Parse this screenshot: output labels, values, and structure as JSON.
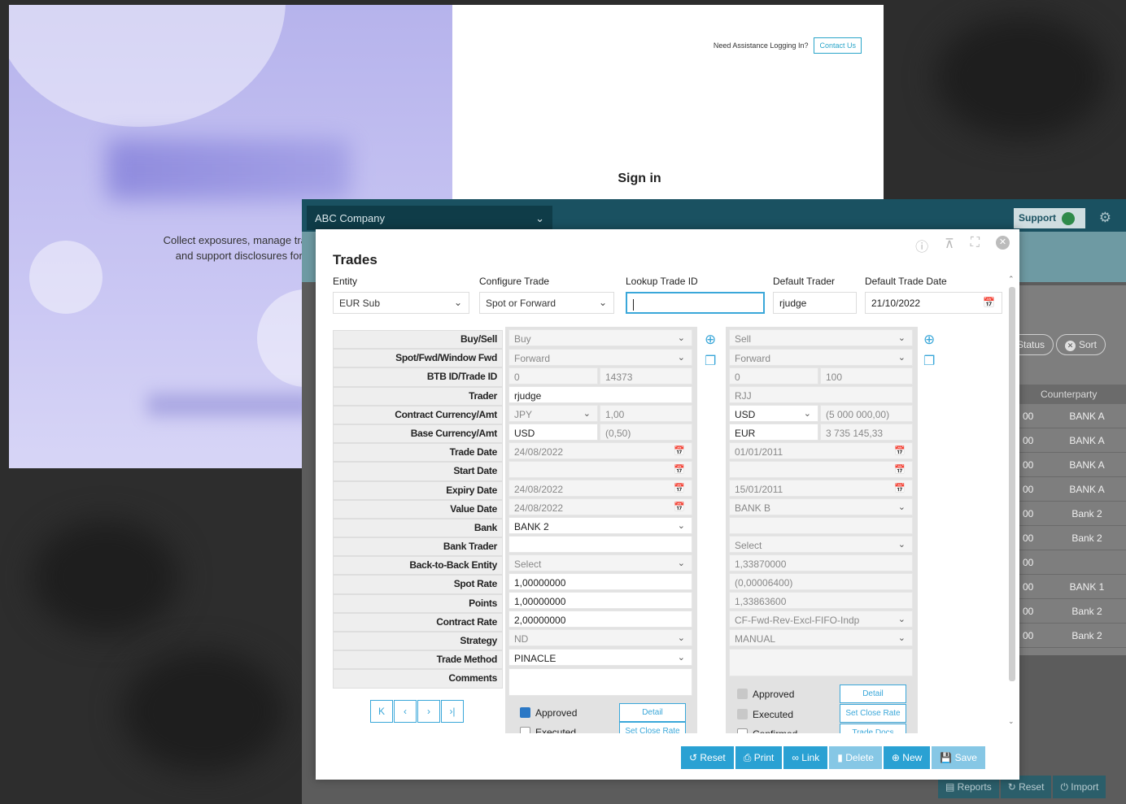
{
  "login": {
    "assist_text": "Need Assistance Logging In?",
    "contact_label": "Contact Us",
    "tagline_line1": "Collect exposures, manage trades, prepare j",
    "tagline_line2": "and support disclosures for foreign curr",
    "signin_title": "Sign in"
  },
  "app": {
    "company": "ABC Company",
    "support_label": "Support",
    "status_pill": "Status",
    "sort_pill": "Sort",
    "column_header": "Counterparty",
    "rows": [
      {
        "a": "00",
        "cp": "BANK A"
      },
      {
        "a": "00",
        "cp": "BANK A"
      },
      {
        "a": "00",
        "cp": "BANK A"
      },
      {
        "a": "00",
        "cp": "BANK A"
      },
      {
        "a": "00",
        "cp": "Bank 2"
      },
      {
        "a": "00",
        "cp": "Bank 2"
      },
      {
        "a": "00",
        "cp": ""
      },
      {
        "a": "00",
        "cp": "BANK 1"
      },
      {
        "a": "00",
        "cp": "Bank 2"
      },
      {
        "a": "00",
        "cp": "Bank 2"
      }
    ],
    "bottom": {
      "reports": "Reports",
      "reset": "Reset",
      "import": "Import"
    }
  },
  "modal": {
    "title": "Trades",
    "fields": {
      "entity_label": "Entity",
      "entity_value": "EUR Sub",
      "configure_label": "Configure Trade",
      "configure_value": "Spot or Forward",
      "lookup_label": "Lookup Trade ID",
      "lookup_value": "",
      "trader_label": "Default Trader",
      "trader_value": "rjudge",
      "date_label": "Default Trade Date",
      "date_value": "21/10/2022"
    },
    "row_labels": [
      "Buy/Sell",
      "Spot/Fwd/Window Fwd",
      "BTB ID/Trade ID",
      "Trader",
      "Contract Currency/Amt",
      "Base Currency/Amt",
      "Trade Date",
      "Start Date",
      "Expiry Date",
      "Value Date",
      "Bank",
      "Bank Trader",
      "Back-to-Back Entity",
      "Spot Rate",
      "Points",
      "Contract Rate",
      "Strategy",
      "Trade Method",
      "Comments"
    ],
    "pager": {
      "first": "K",
      "prev": "‹",
      "next": "›",
      "last": "›|"
    },
    "leg1": {
      "buy_sell": "Buy",
      "spot_fwd": "Forward",
      "btb_id": "0",
      "trade_id": "14373",
      "trader": "rjudge",
      "contract_ccy": "JPY",
      "contract_amt": "1,00",
      "base_ccy": "USD",
      "base_amt": "(0,50)",
      "trade_date": "24/08/2022",
      "start_date": "",
      "expiry_date": "24/08/2022",
      "value_date": "24/08/2022",
      "bank": "BANK 2",
      "bank_trader": "",
      "btb_entity": "Select",
      "spot_rate": "1,00000000",
      "points": "1,00000000",
      "contract_rate": "2,00000000",
      "strategy": "ND",
      "trade_method": "PINACLE",
      "approved": "Approved",
      "executed": "Executed",
      "detail": "Detail",
      "set_close_rate": "Set Close Rate"
    },
    "leg2": {
      "buy_sell": "Sell",
      "spot_fwd": "Forward",
      "btb_id": "0",
      "trade_id": "100",
      "trader": "RJJ",
      "contract_ccy": "USD",
      "contract_amt": "(5 000 000,00)",
      "base_ccy": "EUR",
      "base_amt": "3 735 145,33",
      "trade_date": "01/01/2011",
      "start_date": "",
      "expiry_date": "15/01/2011",
      "value_date": "BANK B",
      "bank": "",
      "bank_trader": "Select",
      "btb_entity": "1,33870000",
      "spot_rate": "(0,00006400)",
      "points": "1,33863600",
      "contract_rate": "CF-Fwd-Rev-Excl-FIFO-Indp",
      "strategy": "MANUAL",
      "approved": "Approved",
      "executed": "Executed",
      "confirmed": "Confirmed",
      "detail": "Detail",
      "set_close_rate": "Set Close Rate",
      "trade_docs": "Trade Docs"
    },
    "actions": {
      "reset": "Reset",
      "print": "Print",
      "link": "Link",
      "delete": "Delete",
      "new": "New",
      "save": "Save"
    }
  }
}
